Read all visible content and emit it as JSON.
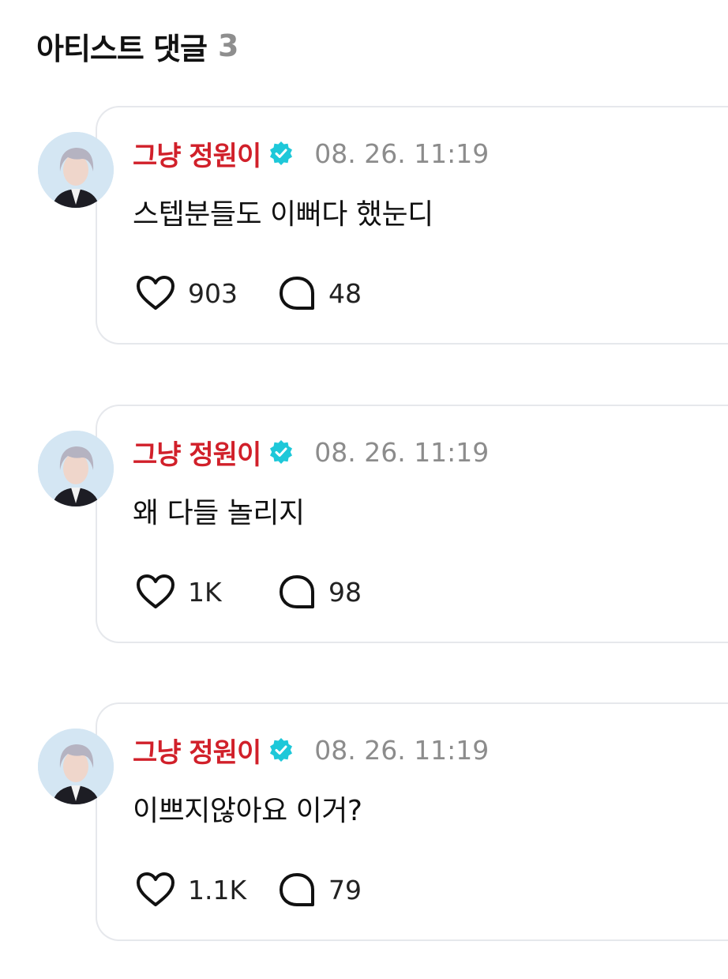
{
  "section": {
    "title": "아티스트 댓글",
    "count": "3"
  },
  "comments": [
    {
      "author": "그냥 정원이",
      "verified": true,
      "time": "08. 26. 11:19",
      "text": "스텝분들도 이뻐다 했눈디",
      "likes": "903",
      "replies": "48"
    },
    {
      "author": "그냥 정원이",
      "verified": true,
      "time": "08. 26. 11:19",
      "text": "왜 다들 놀리지",
      "likes": "1K",
      "replies": "98"
    },
    {
      "author": "그냥 정원이",
      "verified": true,
      "time": "08. 26. 11:19",
      "text": "이쁘지않아요 이거?",
      "likes": "1.1K",
      "replies": "79"
    }
  ],
  "icons": {
    "like": "heart-icon",
    "reply": "speech-bubble-icon",
    "verified": "verified-badge-icon"
  },
  "colors": {
    "author": "#d1202a",
    "verified": "#1ec8d9",
    "time": "#8c8c8c",
    "count_muted": "#8e8e8e"
  }
}
